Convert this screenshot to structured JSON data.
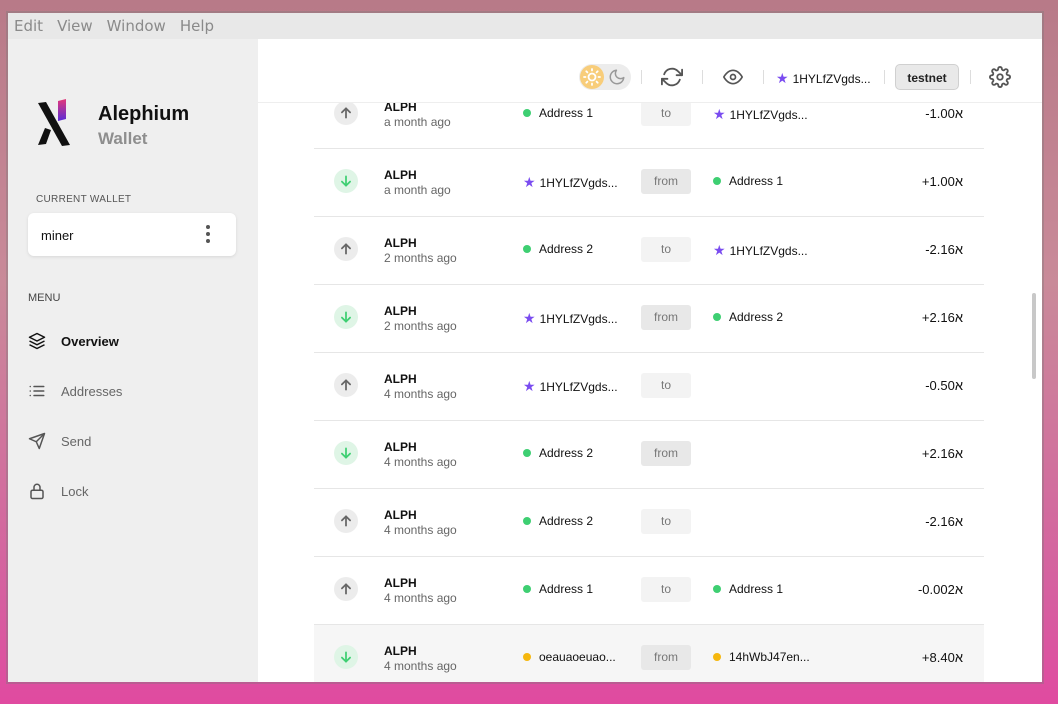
{
  "menubar": {
    "items": [
      "Edit",
      "View",
      "Window",
      "Help"
    ]
  },
  "sidebar": {
    "app_name": "Alephium",
    "app_subtitle": "Wallet",
    "current_wallet_label": "CURRENT WALLET",
    "wallet_name": "miner",
    "menu_label": "MENU",
    "nav": [
      {
        "label": "Overview",
        "icon": "layers-icon",
        "active": true
      },
      {
        "label": "Addresses",
        "icon": "list-icon",
        "active": false
      },
      {
        "label": "Send",
        "icon": "send-icon",
        "active": false
      },
      {
        "label": "Lock",
        "icon": "lock-icon",
        "active": false
      }
    ]
  },
  "topbar": {
    "default_address": "1HYLfZVgds...",
    "network": "testnet",
    "icons": [
      "sun-icon",
      "moon-icon",
      "refresh-icon",
      "eye-icon",
      "star-icon",
      "gear-icon"
    ]
  },
  "transactions": [
    {
      "direction": "out",
      "asset": "ALPH",
      "time": "a month ago",
      "from": "Address 1",
      "from_type": "green",
      "label": "to",
      "to": "1HYLfZVgds...",
      "to_type": "star",
      "amount": "-1.00א"
    },
    {
      "direction": "in",
      "asset": "ALPH",
      "time": "a month ago",
      "from": "1HYLfZVgds...",
      "from_type": "star",
      "label": "from",
      "to": "Address 1",
      "to_type": "green",
      "amount": "+1.00א"
    },
    {
      "direction": "out",
      "asset": "ALPH",
      "time": "2 months ago",
      "from": "Address 2",
      "from_type": "green",
      "label": "to",
      "to": "1HYLfZVgds...",
      "to_type": "star",
      "amount": "-2.16א"
    },
    {
      "direction": "in",
      "asset": "ALPH",
      "time": "2 months ago",
      "from": "1HYLfZVgds...",
      "from_type": "star",
      "label": "from",
      "to": "Address 2",
      "to_type": "green",
      "amount": "+2.16א"
    },
    {
      "direction": "out",
      "asset": "ALPH",
      "time": "4 months ago",
      "from": "1HYLfZVgds...",
      "from_type": "star",
      "label": "to",
      "to": "",
      "to_type": "none",
      "amount": "-0.50א"
    },
    {
      "direction": "in",
      "asset": "ALPH",
      "time": "4 months ago",
      "from": "Address 2",
      "from_type": "green",
      "label": "from",
      "to": "",
      "to_type": "none",
      "amount": "+2.16א"
    },
    {
      "direction": "out",
      "asset": "ALPH",
      "time": "4 months ago",
      "from": "Address 2",
      "from_type": "green",
      "label": "to",
      "to": "",
      "to_type": "none",
      "amount": "-2.16א"
    },
    {
      "direction": "out",
      "asset": "ALPH",
      "time": "4 months ago",
      "from": "Address 1",
      "from_type": "green",
      "label": "to",
      "to": "Address 1",
      "to_type": "green",
      "amount": "-0.002א"
    },
    {
      "direction": "in",
      "asset": "ALPH",
      "time": "4 months ago",
      "from": "oeauaoeuao...",
      "from_type": "yellow",
      "label": "from",
      "to": "14hWbJ47en...",
      "to_type": "yellow",
      "amount": "+8.40א",
      "highlight": true
    }
  ],
  "colors": {
    "green": "#3ecf72",
    "yellow": "#f5b70e",
    "star": "#7a4cf0",
    "accent_sun": "#f8cd7a"
  }
}
